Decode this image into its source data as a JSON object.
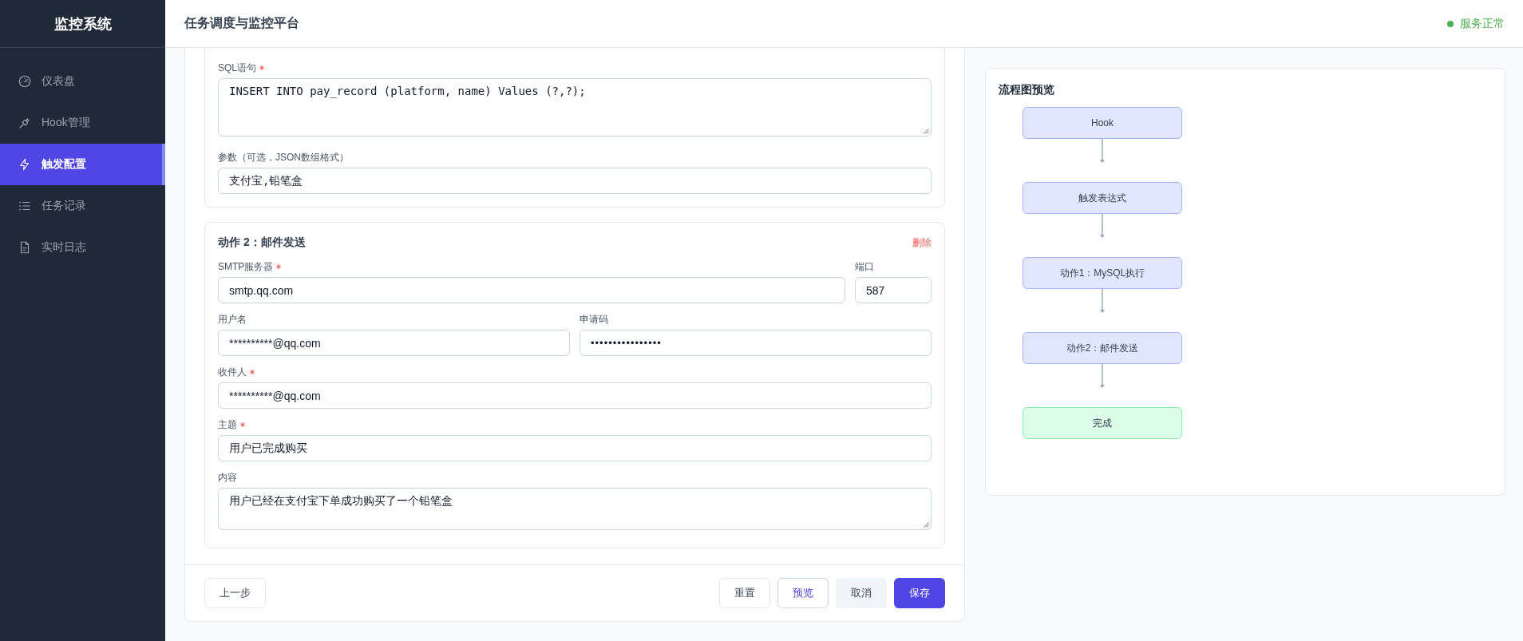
{
  "sidebar": {
    "title": "监控系统",
    "items": [
      {
        "label": "仪表盘",
        "selected": false
      },
      {
        "label": "Hook管理",
        "selected": false
      },
      {
        "label": "触发配置",
        "selected": true
      },
      {
        "label": "任务记录",
        "selected": false
      },
      {
        "label": "实时日志",
        "selected": false
      }
    ]
  },
  "header": {
    "title": "任务调度与监控平台",
    "status": {
      "label": "服务正常",
      "healthy": true
    }
  },
  "form": {
    "actions": [
      {
        "kind": "mysql",
        "rows": [
          [
            {
              "label": "SQL语句",
              "required": true,
              "kind": "textarea",
              "value": "INSERT INTO pay_record (platform, name) Values (?,?);"
            }
          ],
          [
            {
              "label": "参数（可选，JSON数组格式）",
              "required": false,
              "kind": "text",
              "value": "支付宝,铅笔盒"
            }
          ]
        ]
      },
      {
        "kind": "email",
        "title": "动作 2：邮件发送",
        "delete": "删除",
        "rows": [
          [
            {
              "label": "SMTP服务器",
              "required": true,
              "kind": "text",
              "value": "smtp.qq.com"
            },
            {
              "label": "端口",
              "required": false,
              "kind": "number",
              "value": "587"
            }
          ],
          [
            {
              "label": "用户名",
              "required": false,
              "kind": "text",
              "value": "**********@qq.com"
            },
            {
              "label": "申请码",
              "required": false,
              "kind": "password",
              "value": "••••••••••••••••"
            }
          ],
          [
            {
              "label": "收件人",
              "required": true,
              "kind": "text",
              "value": "**********@qq.com"
            }
          ],
          [
            {
              "label": "主题",
              "required": true,
              "kind": "text",
              "value": "用户已完成购买"
            }
          ],
          [
            {
              "label": "内容",
              "required": false,
              "kind": "textarea",
              "value": "用户已经在支付宝下单成功购买了一个铅笔盒"
            }
          ]
        ]
      }
    ],
    "buttons_left": [
      {
        "label": "上一步",
        "kind": "outline"
      }
    ],
    "buttons_right": [
      {
        "label": "重置",
        "kind": "outline"
      },
      {
        "label": "预览",
        "kind": "accent"
      },
      {
        "label": "取消",
        "kind": "muted"
      },
      {
        "label": "保存",
        "kind": "primary"
      }
    ]
  },
  "preview": {
    "title": "流程图预览",
    "nodes": [
      {
        "label": "Hook",
        "kind": "step"
      },
      {
        "label": "触发表达式",
        "kind": "step"
      },
      {
        "label": "动作1：MySQL执行",
        "kind": "step"
      },
      {
        "label": "动作2：邮件发送",
        "kind": "step"
      },
      {
        "label": "完成",
        "kind": "end"
      }
    ]
  }
}
